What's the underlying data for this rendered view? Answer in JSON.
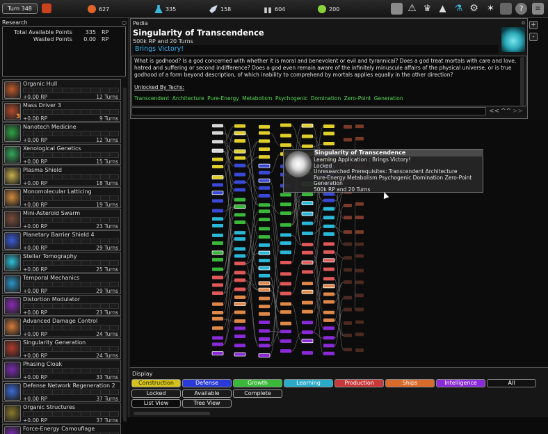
{
  "topbar": {
    "turn_label": "Turn 348",
    "resources": [
      {
        "icon": "industry-gear-icon",
        "value": "627",
        "color": "#e0642a"
      },
      {
        "icon": "research-flask-icon",
        "value": "335",
        "color": "#3bb7d9"
      },
      {
        "icon": "trade-rocket-icon",
        "value": "158",
        "color": "#cfd8e8"
      },
      {
        "icon": "population-icon",
        "value": "604",
        "color": "#cfcfcf"
      },
      {
        "icon": "influence-icon",
        "value": "200",
        "color": "#8ad23a"
      }
    ],
    "menu_icons": [
      "messages-icon",
      "warning-icon",
      "empire-crown-icon",
      "government-icon",
      "research-icon",
      "settings-gear-icon",
      "design-icon",
      "map-icon",
      "help-icon",
      "menu-icon"
    ]
  },
  "research": {
    "title": "Research",
    "total_label": "Total Available Points",
    "total_value": "335",
    "wasted_label": "Wasted Points",
    "wasted_value": "0.00",
    "unit": "RP",
    "queue": [
      {
        "name": "Organic Hull",
        "rp": "+0.00 RP",
        "turns": "12 Turns",
        "color": "#c0592a"
      },
      {
        "name": "Mass Driver 3",
        "rp": "+0.00 RP",
        "turns": "9 Turns",
        "color": "#b34a2b",
        "badge": "3"
      },
      {
        "name": "Nanotech Medicine",
        "rp": "+0.00 RP",
        "turns": "12 Turns",
        "color": "#2ca343"
      },
      {
        "name": "Xenological Genetics",
        "rp": "+0.00 RP",
        "turns": "15 Turns",
        "color": "#33a85a"
      },
      {
        "name": "Plasma Shield",
        "rp": "+0.00 RP",
        "turns": "18 Turns",
        "color": "#c9b04a"
      },
      {
        "name": "Monomolecular Latticing",
        "rp": "+0.00 RP",
        "turns": "19 Turns",
        "color": "#d28a3b"
      },
      {
        "name": "Mini-Asteroid Swarm",
        "rp": "+0.00 RP",
        "turns": "23 Turns",
        "color": "#7a4b3a"
      },
      {
        "name": "Planetary Barrier Shield 4",
        "rp": "+0.00 RP",
        "turns": "29 Turns",
        "color": "#3a5ad8"
      },
      {
        "name": "Stellar Tomography",
        "rp": "+0.00 RP",
        "turns": "25 Turns",
        "color": "#2ec0d8"
      },
      {
        "name": "Temporal Mechanics",
        "rp": "+0.00 RP",
        "turns": "29 Turns",
        "color": "#2a95c8"
      },
      {
        "name": "Distortion Modulator",
        "rp": "+0.00 RP",
        "turns": "23 Turns",
        "color": "#8a2ab8"
      },
      {
        "name": "Advanced Damage Control",
        "rp": "+0.00 RP",
        "turns": "24 Turns",
        "color": "#d87a3a"
      },
      {
        "name": "Singularity Generation",
        "rp": "+0.00 RP",
        "turns": "24 Turns",
        "color": "#b03a2a"
      },
      {
        "name": "Phasing Cloak",
        "rp": "+0.00 RP",
        "turns": "33 Turns",
        "color": "#7a2ab0"
      },
      {
        "name": "Defense Network Regeneration 2",
        "rp": "+0.00 RP",
        "turns": "37 Turns",
        "color": "#3a6ad8"
      },
      {
        "name": "Organic Structures",
        "rp": "+0.00 RP",
        "turns": "37 Turns",
        "color": "#8a7a2a"
      },
      {
        "name": "Force-Energy Camouflage",
        "rp": "",
        "turns": "",
        "color": "#7a2ab0"
      }
    ]
  },
  "pedia": {
    "title": "Pedia",
    "tech_name": "Singularity of Transcendence",
    "tech_cost": "500k RP and 20 Turns",
    "tech_short": "Brings Victory!",
    "description": "What is godhood? Is a god concerned with whether it is moral and benevolent or evil and tyrannical? Does a god treat mortals with care and love, hatred and suffering or second indifference? Does a god even remain aware of the infinitely minuscule affairs of the physical universe, or is true godhood of a form beyond description, of which inability to comprehend by mortals applies equally in the other direction?",
    "unlocked_label": "Unlocked By Techs:",
    "unlocked_by": "Transcendent Architecture  Pure-Energy Metabolism  Psychogenic Domination  Zero-Point Generation",
    "nav_back": "<<",
    "nav_up": "^^",
    "nav_fwd": ">>",
    "close": "o"
  },
  "zoom": {
    "plus": "+",
    "minus": "-"
  },
  "tooltip": {
    "title": "Singularity of Transcendence",
    "line1": "Learning Application  :  Brings Victory!",
    "line2": "Locked",
    "line3": "Unresearched Prerequisites: Transcendent Architecture",
    "line4": "Pure-Energy Metabolism  Psychogenic Domination  Zero-Point",
    "line5": "Generation",
    "line6": "500k RP and 20 Turns"
  },
  "display": {
    "title": "Display",
    "categories": [
      {
        "label": "Construction",
        "color": "#d4c21e",
        "text": "#2a2a00"
      },
      {
        "label": "Defense",
        "color": "#2a3ad8",
        "text": "#ffffff"
      },
      {
        "label": "Growth",
        "color": "#3ab83a",
        "text": "#ffffff"
      },
      {
        "label": "Learning",
        "color": "#2aaac8",
        "text": "#ffffff"
      },
      {
        "label": "Production",
        "color": "#c83a3a",
        "text": "#ffffff"
      },
      {
        "label": "Ships",
        "color": "#d86a2a",
        "text": "#ffffff"
      },
      {
        "label": "Intelligence",
        "color": "#8a2ad8",
        "text": "#ffffff"
      },
      {
        "label": "All",
        "color": "#111111",
        "text": "#ffffff"
      }
    ],
    "status": [
      "Locked",
      "Available",
      "Complete"
    ],
    "views": [
      "List View",
      "Tree View"
    ]
  }
}
